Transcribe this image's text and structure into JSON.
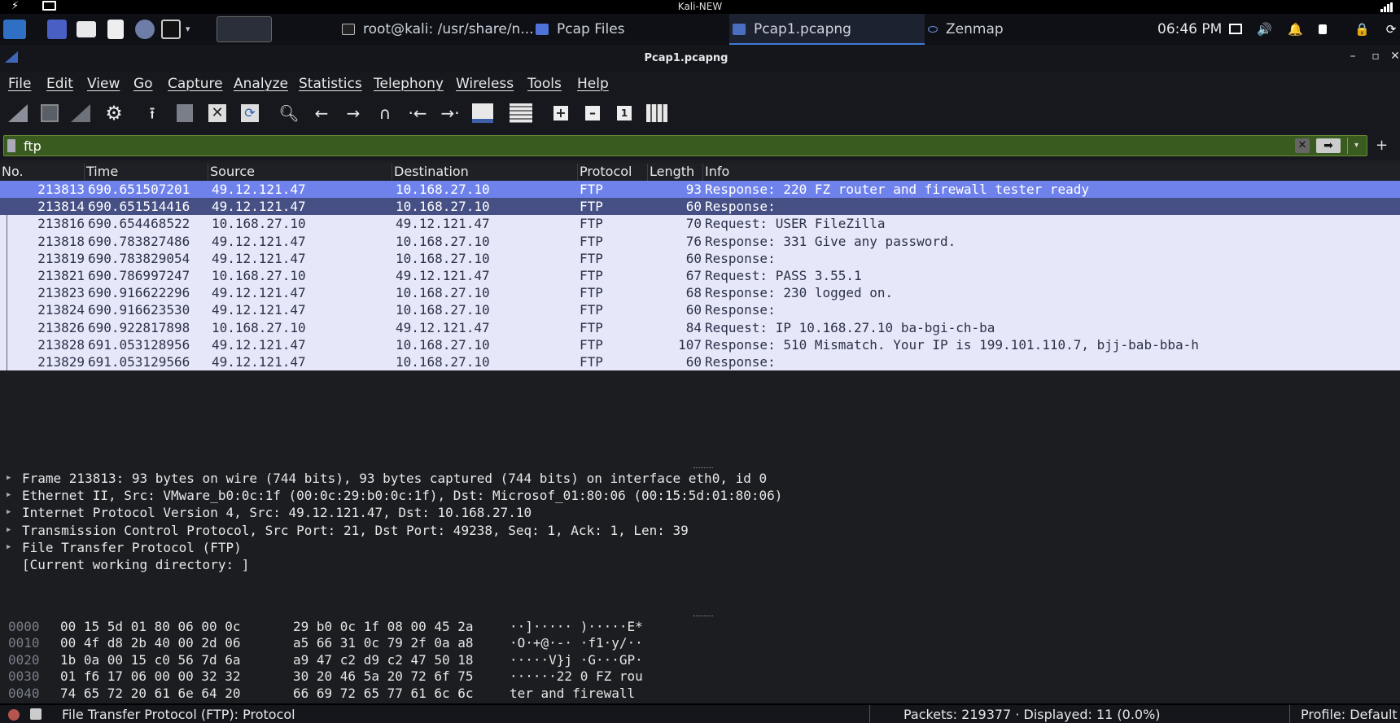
{
  "system_bar": {
    "title": "Kali-NEW"
  },
  "taskbar": {
    "items": [
      {
        "label": "root@kali: /usr/share/n..."
      },
      {
        "label": "Pcap Files"
      },
      {
        "label": "Pcap1.pcapng"
      },
      {
        "label": "Zenmap"
      }
    ],
    "clock": "06:46 PM"
  },
  "window": {
    "title": "Pcap1.pcapng"
  },
  "menu": [
    "File",
    "Edit",
    "View",
    "Go",
    "Capture",
    "Analyze",
    "Statistics",
    "Telephony",
    "Wireless",
    "Tools",
    "Help"
  ],
  "filter": {
    "value": "ftp"
  },
  "packet_list": {
    "columns": [
      "No.",
      "Time",
      "Source",
      "Destination",
      "Protocol",
      "Length",
      "Info"
    ],
    "rows": [
      {
        "no": "213813",
        "time": "690.651507201",
        "src": "49.12.121.47",
        "dst": "10.168.27.10",
        "proto": "FTP",
        "len": "93",
        "info": "Response: 220 FZ router and firewall tester ready"
      },
      {
        "no": "213814",
        "time": "690.651514416",
        "src": "49.12.121.47",
        "dst": "10.168.27.10",
        "proto": "FTP",
        "len": "60",
        "info": "Response:"
      },
      {
        "no": "213816",
        "time": "690.654468522",
        "src": "10.168.27.10",
        "dst": "49.12.121.47",
        "proto": "FTP",
        "len": "70",
        "info": "Request: USER FileZilla"
      },
      {
        "no": "213818",
        "time": "690.783827486",
        "src": "49.12.121.47",
        "dst": "10.168.27.10",
        "proto": "FTP",
        "len": "76",
        "info": "Response: 331 Give any password."
      },
      {
        "no": "213819",
        "time": "690.783829054",
        "src": "49.12.121.47",
        "dst": "10.168.27.10",
        "proto": "FTP",
        "len": "60",
        "info": "Response:"
      },
      {
        "no": "213821",
        "time": "690.786997247",
        "src": "10.168.27.10",
        "dst": "49.12.121.47",
        "proto": "FTP",
        "len": "67",
        "info": "Request: PASS 3.55.1"
      },
      {
        "no": "213823",
        "time": "690.916622296",
        "src": "49.12.121.47",
        "dst": "10.168.27.10",
        "proto": "FTP",
        "len": "68",
        "info": "Response: 230 logged on."
      },
      {
        "no": "213824",
        "time": "690.916623530",
        "src": "49.12.121.47",
        "dst": "10.168.27.10",
        "proto": "FTP",
        "len": "60",
        "info": "Response:"
      },
      {
        "no": "213826",
        "time": "690.922817898",
        "src": "10.168.27.10",
        "dst": "49.12.121.47",
        "proto": "FTP",
        "len": "84",
        "info": "Request: IP 10.168.27.10 ba-bgi-ch-ba"
      },
      {
        "no": "213828",
        "time": "691.053128956",
        "src": "49.12.121.47",
        "dst": "10.168.27.10",
        "proto": "FTP",
        "len": "107",
        "info": "Response: 510 Mismatch. Your IP is 199.101.110.7, bjj-bab-bba-h"
      },
      {
        "no": "213829",
        "time": "691.053129566",
        "src": "49.12.121.47",
        "dst": "10.168.27.10",
        "proto": "FTP",
        "len": "60",
        "info": "Response:"
      }
    ]
  },
  "details": [
    {
      "text": "Frame 213813: 93 bytes on wire (744 bits), 93 bytes captured (744 bits) on interface eth0, id 0",
      "expandable": true
    },
    {
      "text": "Ethernet II, Src: VMware_b0:0c:1f (00:0c:29:b0:0c:1f), Dst: Microsof_01:80:06 (00:15:5d:01:80:06)",
      "expandable": true
    },
    {
      "text": "Internet Protocol Version 4, Src: 49.12.121.47, Dst: 10.168.27.10",
      "expandable": true
    },
    {
      "text": "Transmission Control Protocol, Src Port: 21, Dst Port: 49238, Seq: 1, Ack: 1, Len: 39",
      "expandable": true
    },
    {
      "text": "File Transfer Protocol (FTP)",
      "expandable": true
    },
    {
      "text": "[Current working directory: ]",
      "expandable": false
    }
  ],
  "hex": [
    {
      "off": "0000",
      "b1": "00 15 5d 01 80 06 00 0c",
      "b2": "29 b0 0c 1f 08 00 45 2a",
      "ascii": "··]····· )·····E*"
    },
    {
      "off": "0010",
      "b1": "00 4f d8 2b 40 00 2d 06",
      "b2": "a5 66 31 0c 79 2f 0a a8",
      "ascii": "·O·+@·-· ·f1·y/··"
    },
    {
      "off": "0020",
      "b1": "1b 0a 00 15 c0 56 7d 6a",
      "b2": "a9 47 c2 d9 c2 47 50 18",
      "ascii": "·····V}j ·G···GP·"
    },
    {
      "off": "0030",
      "b1": "01 f6 17 06 00 00 32 32",
      "b2": "30 20 46 5a 20 72 6f 75",
      "ascii": "······22 0 FZ rou"
    },
    {
      "off": "0040",
      "b1": "74 65 72 20 61 6e 64 20",
      "b2": "66 69 72 65 77 61 6c 6c",
      "ascii": "ter and  firewall"
    }
  ],
  "status": {
    "left": "File Transfer Protocol (FTP): Protocol",
    "middle": "Packets: 219377 · Displayed: 11 (0.0%)",
    "right": "Profile: Default"
  },
  "icons": {
    "toolbar": [
      "shark-fin-icon",
      "stop-icon",
      "restart-icon",
      "options-gear-icon",
      "open-icon",
      "save-icon",
      "close-file-icon",
      "reload-icon",
      "search-icon",
      "back-icon",
      "forward-icon",
      "goto-icon",
      "first-icon",
      "last-icon",
      "autoscroll-icon",
      "colorize-icon",
      "zoom-in-icon",
      "zoom-out-icon",
      "normal-size-icon",
      "resize-columns-icon"
    ]
  },
  "colors": {
    "selected_row": "#6f82ec",
    "row_bg": "#e6e8fa",
    "filter_bg": "#3a5b1f"
  }
}
